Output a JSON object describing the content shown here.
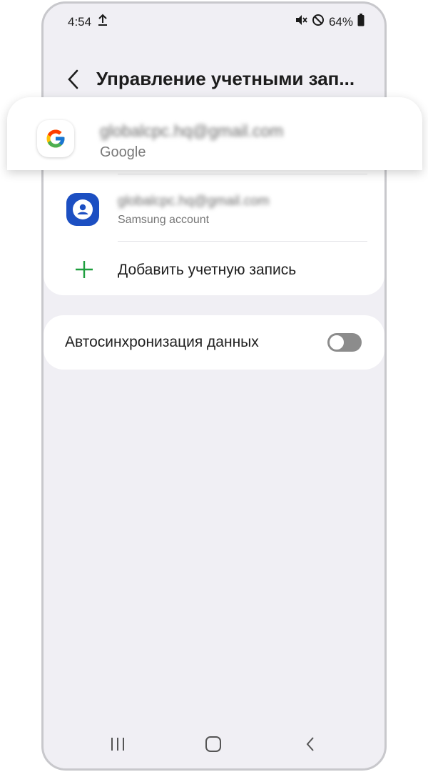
{
  "status_bar": {
    "time": "4:54",
    "battery": "64%",
    "icons": [
      "upload-icon",
      "mute-icon",
      "do-not-disturb-icon",
      "battery-icon"
    ]
  },
  "header": {
    "title": "Управление учетными зап..."
  },
  "accounts": [
    {
      "email": "globalcpc.hq@gmail.com",
      "type": "Google",
      "icon": "google-icon"
    },
    {
      "email": "globalcpc.hq@gmail.com",
      "type": "Samsung account",
      "icon": "samsung-account-icon"
    }
  ],
  "add_account": {
    "label": "Добавить учетную запись",
    "icon": "plus-icon"
  },
  "auto_sync": {
    "label": "Автосинхронизация данных",
    "enabled": false
  },
  "navbar": {
    "icons": [
      "recents-icon",
      "home-icon",
      "back-icon"
    ]
  },
  "colors": {
    "background": "#f0eff4",
    "samsung_blue": "#1c4fc2",
    "plus_green": "#1e9e3e",
    "toggle_off": "#8c8c8c"
  }
}
